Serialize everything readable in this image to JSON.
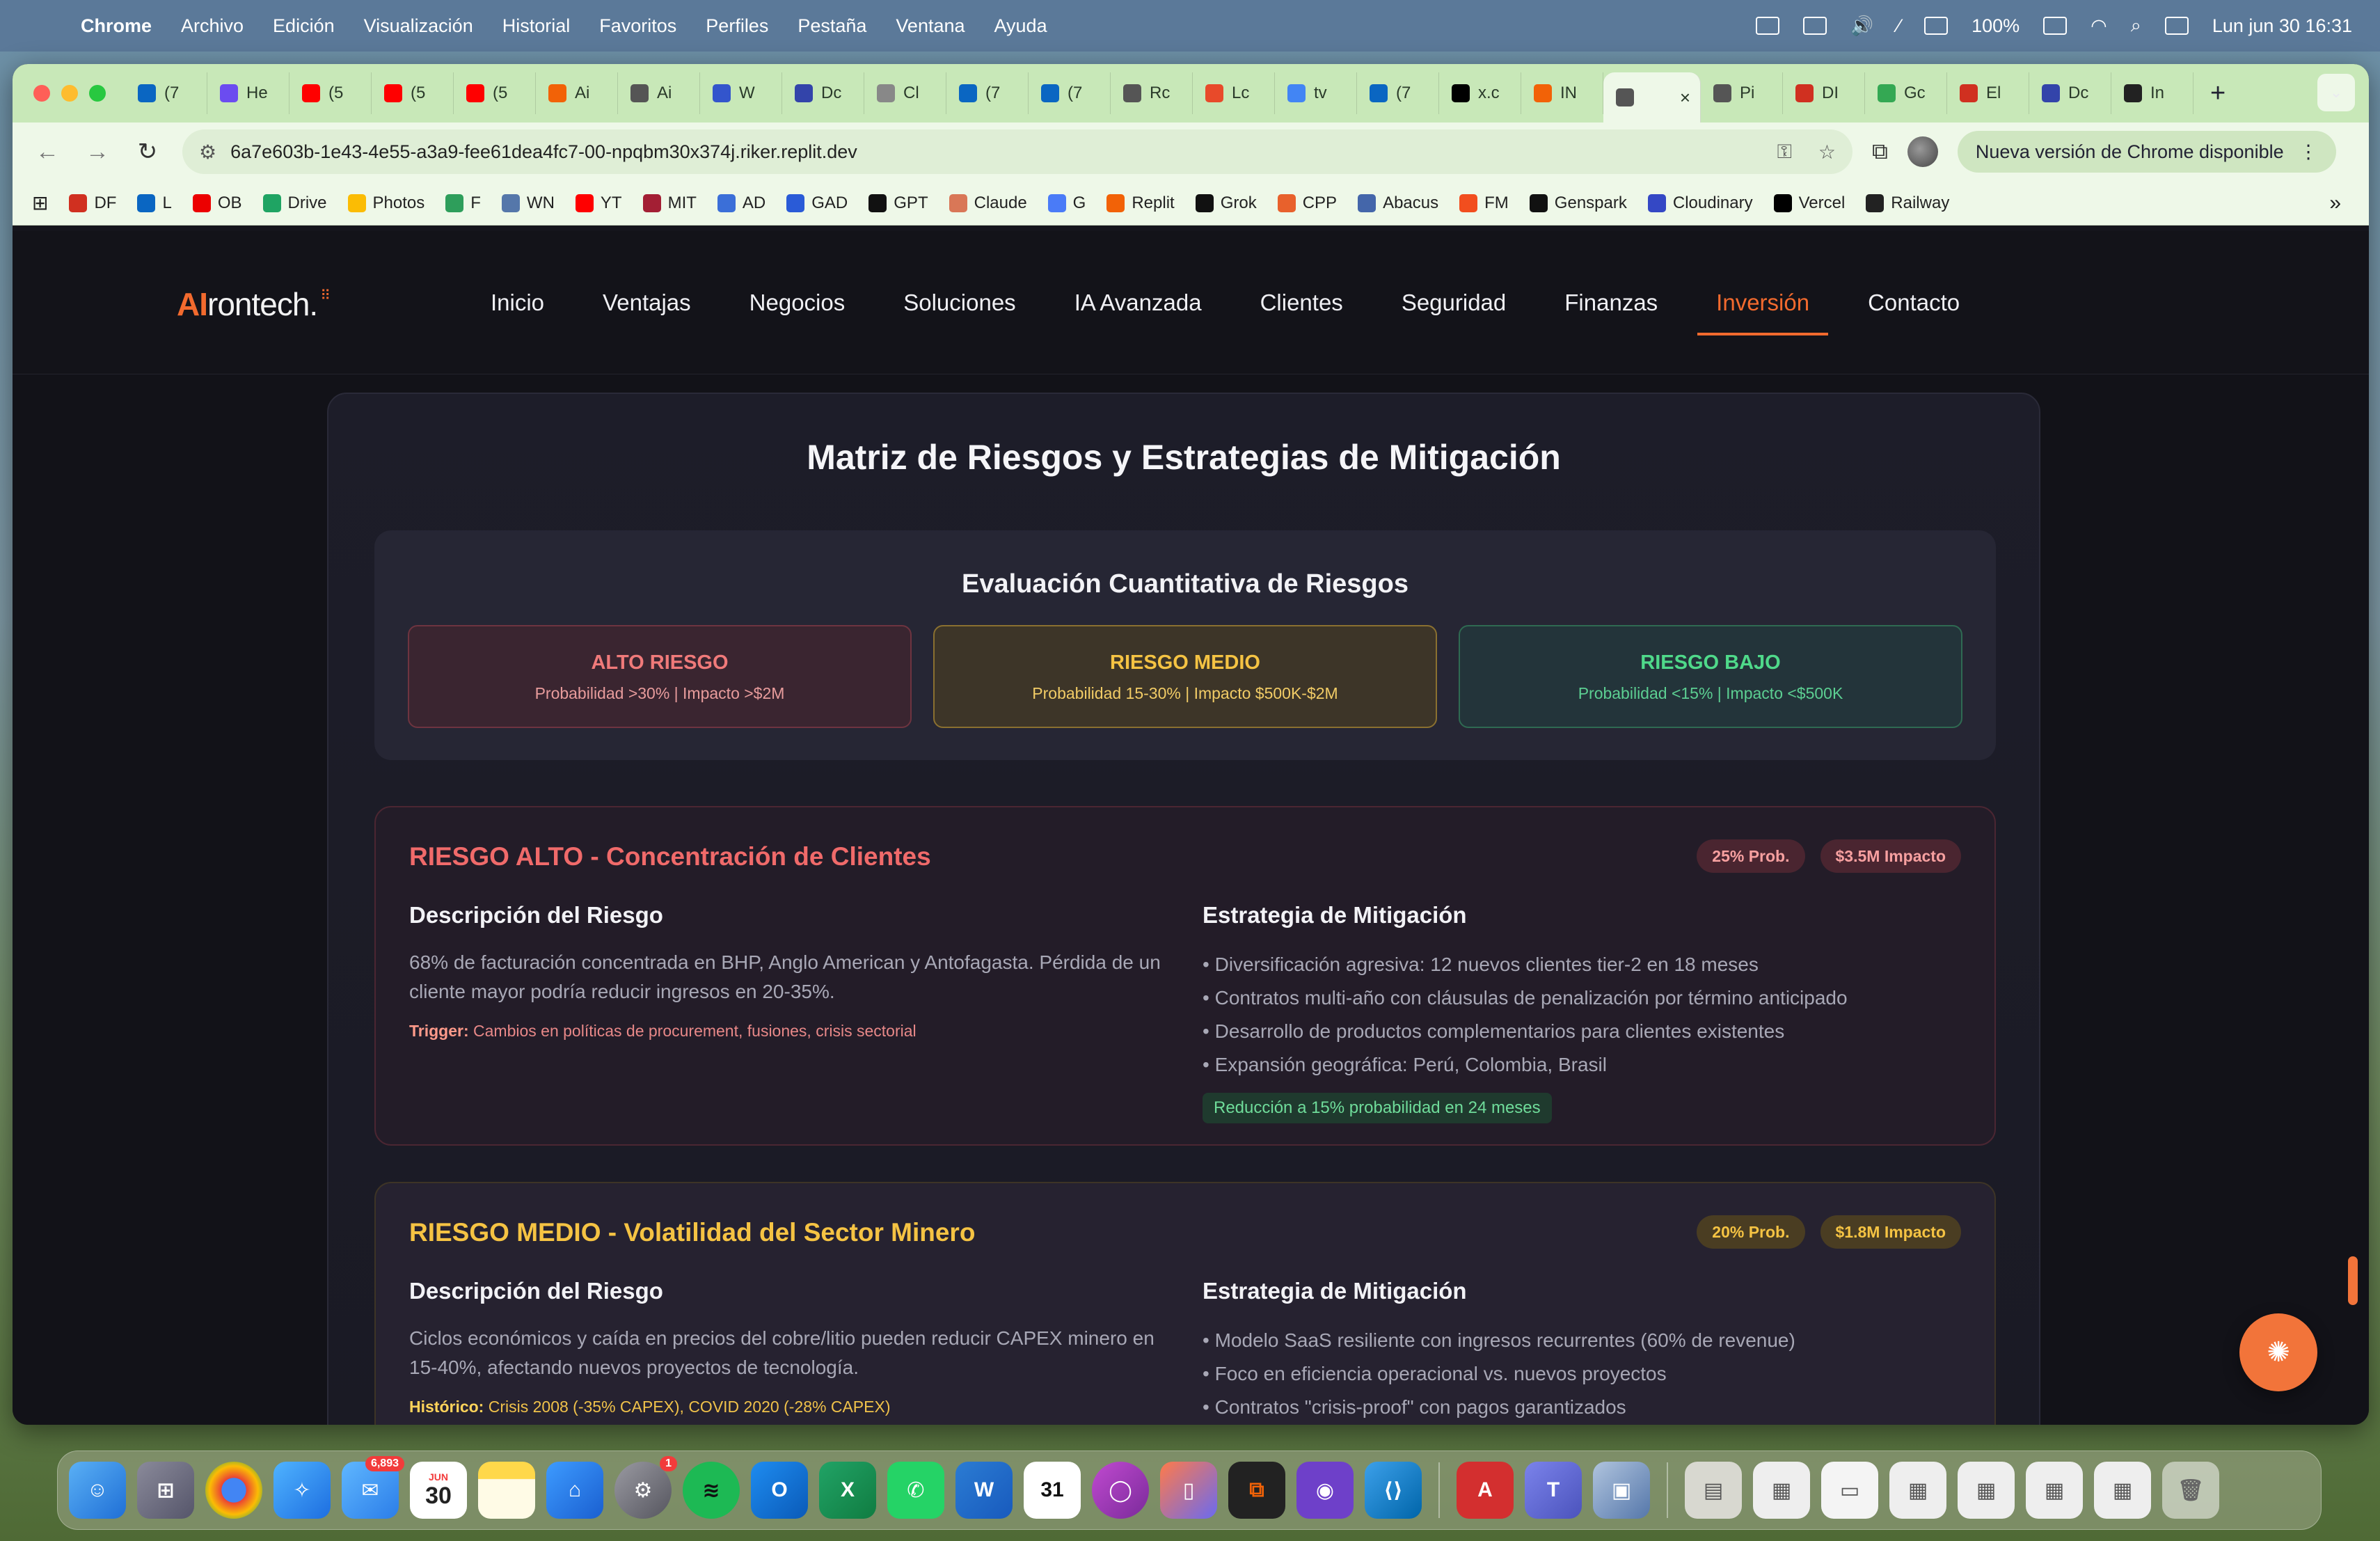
{
  "menubar": {
    "app": "Chrome",
    "items": [
      "Archivo",
      "Edición",
      "Visualización",
      "Historial",
      "Favoritos",
      "Perfiles",
      "Pestaña",
      "Ventana",
      "Ayuda"
    ],
    "battery": "100%",
    "datetime": "Lun jun 30  16:31"
  },
  "tabs": [
    {
      "label": "(7",
      "icon": "linkedin-icon",
      "color": "#0a66c2"
    },
    {
      "label": "He",
      "icon": "video-icon",
      "color": "#6b4cf0"
    },
    {
      "label": "(5",
      "icon": "youtube-icon",
      "color": "#ff0000"
    },
    {
      "label": "(5",
      "icon": "youtube-icon",
      "color": "#ff0000"
    },
    {
      "label": "(5",
      "icon": "youtube-icon",
      "color": "#ff0000"
    },
    {
      "label": "Ai",
      "icon": "replit-icon",
      "color": "#f26207"
    },
    {
      "label": "Ai",
      "icon": "globe-icon",
      "color": "#555555"
    },
    {
      "label": "W",
      "icon": "app-icon",
      "color": "#3355cc"
    },
    {
      "label": "Dc",
      "icon": "docs-icon",
      "color": "#3344aa"
    },
    {
      "label": "Cl",
      "icon": "sparkle-icon",
      "color": "#888888"
    },
    {
      "label": "(7",
      "icon": "linkedin-icon",
      "color": "#0a66c2"
    },
    {
      "label": "(7",
      "icon": "linkedin-icon",
      "color": "#0a66c2"
    },
    {
      "label": "Rc",
      "icon": "globe-icon",
      "color": "#555555"
    },
    {
      "label": "Lc",
      "icon": "app-icon",
      "color": "#e84a2a"
    },
    {
      "label": "tv",
      "icon": "google-icon",
      "color": "#4285f4"
    },
    {
      "label": "(7",
      "icon": "linkedin-icon",
      "color": "#0a66c2"
    },
    {
      "label": "x.c",
      "icon": "x-icon",
      "color": "#000000"
    },
    {
      "label": "IN",
      "icon": "replit-icon",
      "color": "#f26207"
    },
    {
      "label": "",
      "icon": "globe-icon",
      "color": "#555555",
      "active": true
    },
    {
      "label": "Pi",
      "icon": "globe-icon",
      "color": "#555555"
    },
    {
      "label": "DI",
      "icon": "df-icon",
      "color": "#d03020"
    },
    {
      "label": "Gc",
      "icon": "app-icon",
      "color": "#34a853"
    },
    {
      "label": "El",
      "icon": "df-icon",
      "color": "#d03020"
    },
    {
      "label": "Dc",
      "icon": "docs-icon",
      "color": "#3344aa"
    },
    {
      "label": "In",
      "icon": "app-icon",
      "color": "#222222"
    }
  ],
  "toolbar": {
    "url": "6a7e603b-1e43-4e55-a3a9-fee61dea4fc7-00-npqbm30x374j.riker.replit.dev",
    "update_label": "Nueva versión de Chrome disponible"
  },
  "bookmarks": [
    {
      "label": "DF",
      "icon": "df-icon",
      "color": "#d03020"
    },
    {
      "label": "L",
      "icon": "linkedin-icon",
      "color": "#0a66c2"
    },
    {
      "label": "OB",
      "icon": "santander-icon",
      "color": "#ec0000"
    },
    {
      "label": "Drive",
      "icon": "drive-icon",
      "color": "#1fa463"
    },
    {
      "label": "Photos",
      "icon": "photos-icon",
      "color": "#fbbc04"
    },
    {
      "label": "F",
      "icon": "app-icon",
      "color": "#2e9e5b"
    },
    {
      "label": "WN",
      "icon": "app-icon",
      "color": "#5577aa"
    },
    {
      "label": "YT",
      "icon": "youtube-icon",
      "color": "#ff0000"
    },
    {
      "label": "MIT",
      "icon": "mit-icon",
      "color": "#a31f34"
    },
    {
      "label": "AD",
      "icon": "app-icon",
      "color": "#3b6fd8"
    },
    {
      "label": "GAD",
      "icon": "app-icon",
      "color": "#2a5bd7"
    },
    {
      "label": "GPT",
      "icon": "openai-icon",
      "color": "#111111"
    },
    {
      "label": "Claude",
      "icon": "claude-icon",
      "color": "#d97757"
    },
    {
      "label": "G",
      "icon": "gemini-icon",
      "color": "#4a7bf7"
    },
    {
      "label": "Replit",
      "icon": "replit-icon",
      "color": "#f26207"
    },
    {
      "label": "Grok",
      "icon": "grok-icon",
      "color": "#111111"
    },
    {
      "label": "CPP",
      "icon": "app-icon",
      "color": "#e8612c"
    },
    {
      "label": "Abacus",
      "icon": "app-icon",
      "color": "#4466aa"
    },
    {
      "label": "FM",
      "icon": "figma-icon",
      "color": "#f24e1e"
    },
    {
      "label": "Genspark",
      "icon": "app-icon",
      "color": "#111111"
    },
    {
      "label": "Cloudinary",
      "icon": "app-icon",
      "color": "#3448c5"
    },
    {
      "label": "Vercel",
      "icon": "vercel-icon",
      "color": "#000000"
    },
    {
      "label": "Railway",
      "icon": "app-icon",
      "color": "#222222"
    }
  ],
  "site": {
    "logo_ai": "AI",
    "logo_rest": "rontech.",
    "nav": [
      "Inicio",
      "Ventajas",
      "Negocios",
      "Soluciones",
      "IA Avanzada",
      "Clientes",
      "Seguridad",
      "Finanzas",
      "Inversión",
      "Contacto"
    ],
    "active_nav": "Inversión"
  },
  "content": {
    "title": "Matriz de Riesgos y Estrategias de Mitigación",
    "eval_title": "Evaluación Cuantitativa de Riesgos",
    "levels": [
      {
        "name": "ALTO RIESGO",
        "desc": "Probabilidad >30% | Impacto >$2M"
      },
      {
        "name": "RIESGO MEDIO",
        "desc": "Probabilidad 15-30% | Impacto $500K-$2M"
      },
      {
        "name": "RIESGO BAJO",
        "desc": "Probabilidad <15% | Impacto <$500K"
      }
    ],
    "risk_high": {
      "title": "RIESGO ALTO - Concentración de Clientes",
      "prob": "25% Prob.",
      "impact": "$3.5M Impacto",
      "desc_head": "Descripción del Riesgo",
      "desc": "68% de facturación concentrada en BHP, Anglo American y Antofagasta. Pérdida de un cliente mayor podría reducir ingresos en 20-35%.",
      "trigger_label": "Trigger:",
      "trigger": "Cambios en políticas de procurement, fusiones, crisis sectorial",
      "strat_head": "Estrategia de Mitigación",
      "strategies": [
        "Diversificación agresiva: 12 nuevos clientes tier-2 en 18 meses",
        "Contratos multi-año con cláusulas de penalización por término anticipado",
        "Desarrollo de productos complementarios para clientes existentes",
        "Expansión geográfica: Perú, Colombia, Brasil"
      ],
      "result": "Reducción a 15% probabilidad en 24 meses"
    },
    "risk_mid": {
      "title": "RIESGO MEDIO - Volatilidad del Sector Minero",
      "prob": "20% Prob.",
      "impact": "$1.8M Impacto",
      "desc_head": "Descripción del Riesgo",
      "desc": "Ciclos económicos y caída en precios del cobre/litio pueden reducir CAPEX minero en 15-40%, afectando nuevos proyectos de tecnología.",
      "trigger_label": "Histórico:",
      "trigger": "Crisis 2008 (-35% CAPEX), COVID 2020 (-28% CAPEX)",
      "strat_head": "Estrategia de Mitigación",
      "strategies": [
        "Modelo SaaS resiliente con ingresos recurrentes (60% de revenue)",
        "Foco en eficiencia operacional vs. nuevos proyectos",
        "Contratos \"crisis-proof\" con pagos garantizados"
      ]
    }
  },
  "dock": {
    "mail_badge": "6,893",
    "calendar_month": "JUN",
    "calendar_day": "30",
    "settings_badge": "1"
  },
  "colors": {
    "accent": "#f26a2e",
    "high": "#f06a6a",
    "medium": "#f5c343",
    "low": "#4fd98a"
  }
}
